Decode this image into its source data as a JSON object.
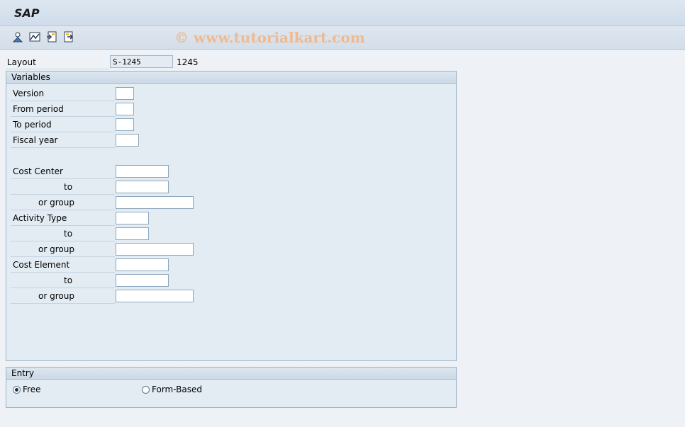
{
  "title": "SAP",
  "watermark": "© www.tutorialkart.com",
  "toolbar": {
    "icons": [
      "person-icon",
      "chart-icon",
      "get-variant-icon",
      "save-variant-icon"
    ]
  },
  "layout": {
    "label": "Layout",
    "value": "S-1245",
    "description": "1245"
  },
  "variables": {
    "header": "Variables",
    "version": {
      "label": "Version",
      "value": ""
    },
    "from_period": {
      "label": "From period",
      "value": ""
    },
    "to_period": {
      "label": "To period",
      "value": ""
    },
    "fiscal_year": {
      "label": "Fiscal year",
      "value": ""
    },
    "cost_center": {
      "label": "Cost Center",
      "to_label": "to",
      "group_label": "or group"
    },
    "activity_type": {
      "label": "Activity Type",
      "to_label": "to",
      "group_label": "or group"
    },
    "cost_element": {
      "label": "Cost Element",
      "to_label": "to",
      "group_label": "or group"
    }
  },
  "entry": {
    "header": "Entry",
    "free_label": "Free",
    "form_based_label": "Form-Based",
    "selected": "Free"
  },
  "colors": {
    "background": "#eef2f6",
    "group_border": "#9fb4c8",
    "watermark": "#f0b98f"
  }
}
